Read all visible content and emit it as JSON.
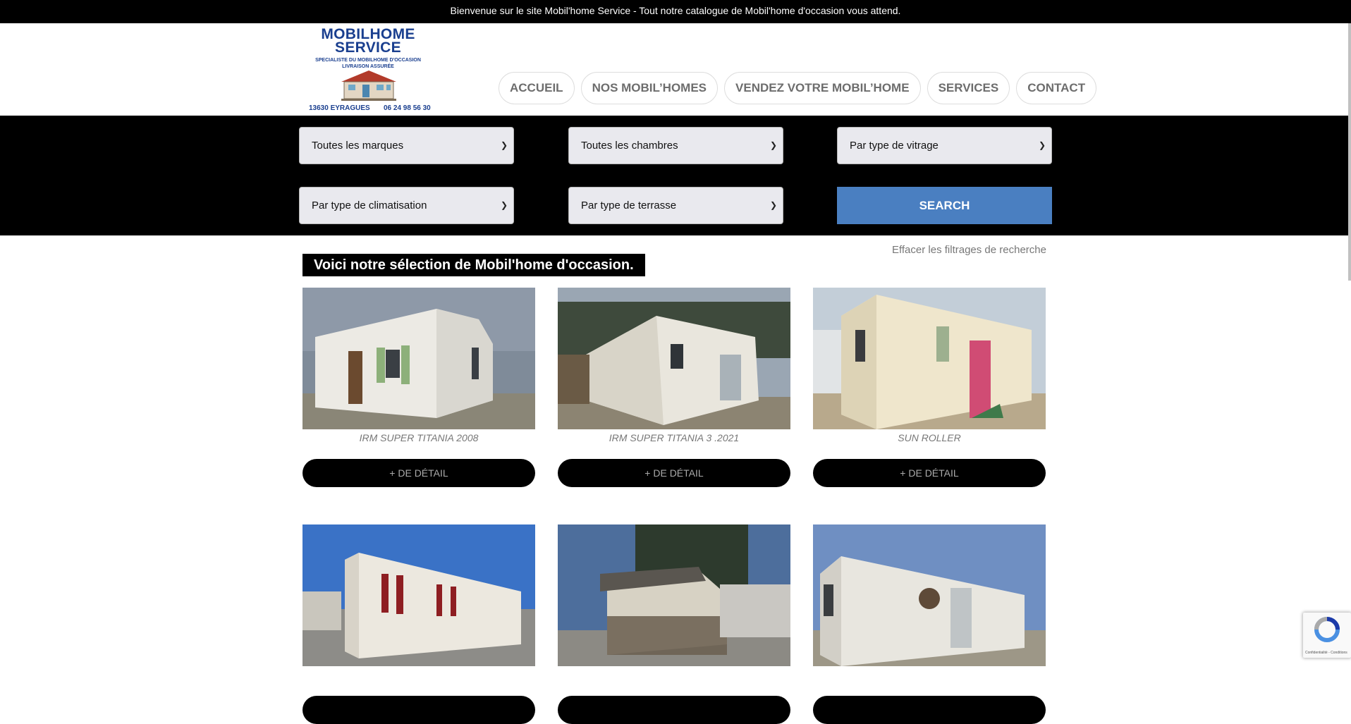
{
  "topbar": {
    "text": "Bienvenue sur le site Mobil'home Service - Tout notre catalogue de Mobil'home d'occasion vous attend."
  },
  "logo": {
    "line1": "MOBILHOME",
    "line2": "SERVICE",
    "line3": "SPECIALISTE DU MOBILHOME D'OCCASION",
    "line4": "LIVRAISON ASSURÉE",
    "city": "13630 EYRAGUES",
    "phone": "06 24 98 56 30"
  },
  "nav": {
    "items": [
      {
        "label": "ACCUEIL"
      },
      {
        "label": "NOS MOBIL’HOMES"
      },
      {
        "label": "VENDEZ VOTRE MOBIL’HOME"
      },
      {
        "label": "SERVICES"
      },
      {
        "label": "CONTACT"
      }
    ]
  },
  "filters": {
    "brand": "Toutes les marques",
    "rooms": "Toutes les chambres",
    "glazing": "Par type de vitrage",
    "aircon": "Par type de climatisation",
    "terrace": "Par type de terrasse",
    "search_label": "SEARCH",
    "clear_label": "Effacer les filtrages de recherche"
  },
  "section": {
    "title": "Voici notre sélection de Mobil'home d'occasion."
  },
  "listings": [
    {
      "name": "IRM SUPER TITANIA 2008",
      "button": "+ DE DÉTAIL"
    },
    {
      "name": "IRM SUPER TITANIA 3 .2021",
      "button": "+ DE DÉTAIL"
    },
    {
      "name": "SUN ROLLER",
      "button": "+ DE DÉTAIL"
    },
    {
      "name": "",
      "button": ""
    },
    {
      "name": "",
      "button": ""
    },
    {
      "name": "",
      "button": ""
    }
  ],
  "colors": {
    "accent": "#4a7fc1",
    "dark": "#000000",
    "logo_blue": "#1a3f8f"
  },
  "recaptcha": {
    "text": "Confidentialité - Conditions"
  }
}
